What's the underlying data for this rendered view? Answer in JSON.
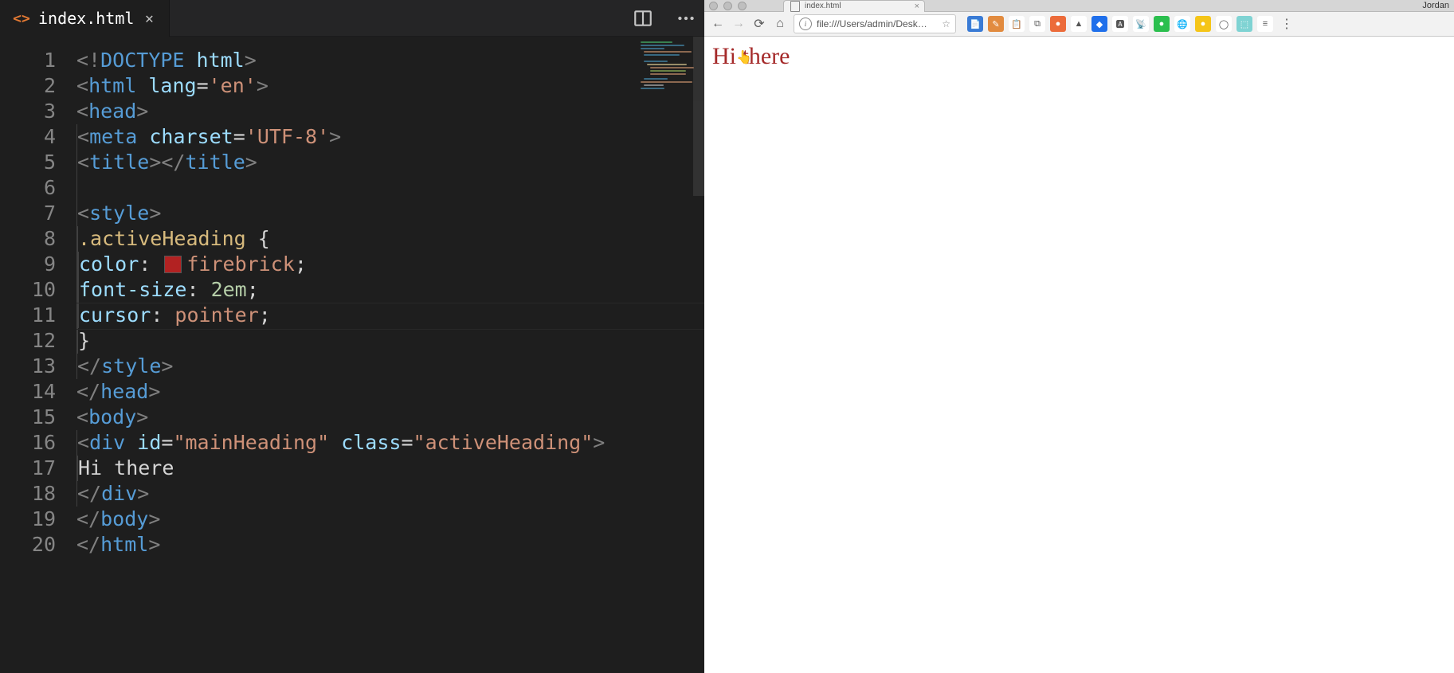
{
  "editor": {
    "tab_filename": "index.html",
    "line_count": 20,
    "highlighted_line": 11,
    "lines": [
      {
        "n": 1,
        "segs": [
          [
            "<!",
            "c-gray"
          ],
          [
            "DOCTYPE",
            "c-blue"
          ],
          [
            " ",
            "c-white"
          ],
          [
            "html",
            "c-lblue"
          ],
          [
            ">",
            "c-gray"
          ]
        ]
      },
      {
        "n": 2,
        "segs": [
          [
            "<",
            "c-gray"
          ],
          [
            "html",
            "c-blue"
          ],
          [
            " ",
            "c-white"
          ],
          [
            "lang",
            "c-lblue"
          ],
          [
            "=",
            "c-white"
          ],
          [
            "'en'",
            "c-orange"
          ],
          [
            ">",
            "c-gray"
          ]
        ]
      },
      {
        "n": 3,
        "segs": [
          [
            "<",
            "c-gray"
          ],
          [
            "head",
            "c-blue"
          ],
          [
            ">",
            "c-gray"
          ]
        ]
      },
      {
        "n": 4,
        "indent": 1,
        "segs": [
          [
            "<",
            "c-gray"
          ],
          [
            "meta",
            "c-blue"
          ],
          [
            " ",
            "c-white"
          ],
          [
            "charset",
            "c-lblue"
          ],
          [
            "=",
            "c-white"
          ],
          [
            "'UTF-8'",
            "c-orange"
          ],
          [
            ">",
            "c-gray"
          ]
        ]
      },
      {
        "n": 5,
        "indent": 1,
        "segs": [
          [
            "<",
            "c-gray"
          ],
          [
            "title",
            "c-blue"
          ],
          [
            "></",
            "c-gray"
          ],
          [
            "title",
            "c-blue"
          ],
          [
            ">",
            "c-gray"
          ]
        ]
      },
      {
        "n": 6,
        "indent": 1,
        "segs": []
      },
      {
        "n": 7,
        "indent": 1,
        "segs": [
          [
            "<",
            "c-gray"
          ],
          [
            "style",
            "c-blue"
          ],
          [
            ">",
            "c-gray"
          ]
        ]
      },
      {
        "n": 8,
        "indent": 2,
        "segs": [
          [
            ".activeHeading",
            "c-yellow"
          ],
          [
            " {",
            "c-white"
          ]
        ]
      },
      {
        "n": 9,
        "indent": 3,
        "segs": [
          [
            "color",
            "c-lblue"
          ],
          [
            ": ",
            "c-white"
          ],
          [
            "SWATCH",
            ""
          ],
          [
            "firebrick",
            "c-orange"
          ],
          [
            ";",
            "c-white"
          ]
        ]
      },
      {
        "n": 10,
        "indent": 3,
        "segs": [
          [
            "font-size",
            "c-lblue"
          ],
          [
            ": ",
            "c-white"
          ],
          [
            "2em",
            "c-green"
          ],
          [
            ";",
            "c-white"
          ]
        ]
      },
      {
        "n": 11,
        "indent": 3,
        "segs": [
          [
            "cursor",
            "c-lblue"
          ],
          [
            ": ",
            "c-white"
          ],
          [
            "pointer",
            "c-orange"
          ],
          [
            ";",
            "c-white"
          ]
        ]
      },
      {
        "n": 12,
        "indent": 2,
        "segs": [
          [
            "}",
            "c-white"
          ]
        ]
      },
      {
        "n": 13,
        "indent": 1,
        "segs": [
          [
            "</",
            "c-gray"
          ],
          [
            "style",
            "c-blue"
          ],
          [
            ">",
            "c-gray"
          ]
        ]
      },
      {
        "n": 14,
        "segs": [
          [
            "</",
            "c-gray"
          ],
          [
            "head",
            "c-blue"
          ],
          [
            ">",
            "c-gray"
          ]
        ]
      },
      {
        "n": 15,
        "segs": [
          [
            "<",
            "c-gray"
          ],
          [
            "body",
            "c-blue"
          ],
          [
            ">",
            "c-gray"
          ]
        ]
      },
      {
        "n": 16,
        "indent": 1,
        "segs": [
          [
            "<",
            "c-gray"
          ],
          [
            "div",
            "c-blue"
          ],
          [
            " ",
            "c-white"
          ],
          [
            "id",
            "c-lblue"
          ],
          [
            "=",
            "c-white"
          ],
          [
            "\"mainHeading\"",
            "c-orange"
          ],
          [
            " ",
            "c-white"
          ],
          [
            "class",
            "c-lblue"
          ],
          [
            "=",
            "c-white"
          ],
          [
            "\"activeHeading\"",
            "c-orange"
          ],
          [
            ">",
            "c-gray"
          ]
        ]
      },
      {
        "n": 17,
        "indent": 2,
        "segs": [
          [
            "Hi there",
            "c-white"
          ]
        ]
      },
      {
        "n": 18,
        "indent": 1,
        "segs": [
          [
            "</",
            "c-gray"
          ],
          [
            "div",
            "c-blue"
          ],
          [
            ">",
            "c-gray"
          ]
        ]
      },
      {
        "n": 19,
        "segs": [
          [
            "</",
            "c-gray"
          ],
          [
            "body",
            "c-blue"
          ],
          [
            ">",
            "c-gray"
          ]
        ]
      },
      {
        "n": 20,
        "segs": [
          [
            "</",
            "c-gray"
          ],
          [
            "html",
            "c-blue"
          ],
          [
            ">",
            "c-gray"
          ]
        ]
      }
    ]
  },
  "browser": {
    "tab_title": "index.html",
    "url": "file:///Users/admin/Desk…",
    "profile_name": "Jordan",
    "page_heading": "Hi there",
    "extensions": [
      {
        "bg": "#3a7bd5",
        "glyph": "📄"
      },
      {
        "bg": "#e28b3f",
        "glyph": "✎"
      },
      {
        "bg": "#ffffff",
        "glyph": "📋"
      },
      {
        "bg": "#ffffff",
        "glyph": "⧉"
      },
      {
        "bg": "#ec6b3a",
        "glyph": "●"
      },
      {
        "bg": "#ffffff",
        "glyph": "▲"
      },
      {
        "bg": "#1f6feb",
        "glyph": "◆"
      },
      {
        "bg": "#ffffff",
        "glyph": "🅰"
      },
      {
        "bg": "#ffffff",
        "glyph": "📡"
      },
      {
        "bg": "#2bbf4e",
        "glyph": "●"
      },
      {
        "bg": "#ffffff",
        "glyph": "🌐"
      },
      {
        "bg": "#f5c518",
        "glyph": "●"
      },
      {
        "bg": "#ffffff",
        "glyph": "◯"
      },
      {
        "bg": "#7fd3d3",
        "glyph": "⬚"
      },
      {
        "bg": "#ffffff",
        "glyph": "≡"
      }
    ]
  }
}
